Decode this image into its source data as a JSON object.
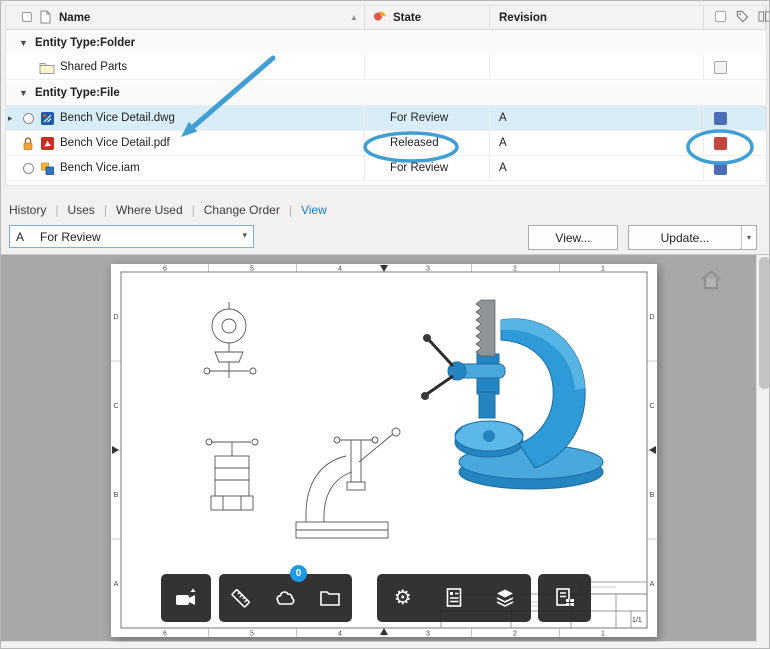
{
  "icons": {
    "sort_asc": "▲",
    "group_expanded": "▼",
    "row_current": "▸",
    "combo_chevron": "▾",
    "split_chevron": "▾",
    "gear": "⚙"
  },
  "grid": {
    "columns": {
      "name": "Name",
      "state": "State",
      "revision": "Revision"
    },
    "group_folder": "Entity Type:Folder",
    "group_file": "Entity Type:File",
    "rows": {
      "shared": {
        "name": "Shared Parts"
      },
      "dwg": {
        "name": "Bench Vice Detail.dwg",
        "state": "For Review",
        "revision": "A",
        "status_color": "#4a6db5"
      },
      "pdf": {
        "name": "Bench Vice Detail.pdf",
        "state": "Released",
        "revision": "A",
        "status_color": "#c2473d"
      },
      "iam": {
        "name": "Bench Vice.iam",
        "state": "For Review",
        "revision": "A",
        "status_color": "#4a6db5"
      }
    }
  },
  "tabs": {
    "items": [
      "History",
      "Uses",
      "Where Used",
      "Change Order",
      "View"
    ],
    "separator": "|",
    "active": "View"
  },
  "controls": {
    "revision": "A",
    "state": "For Review",
    "view_button": "View...",
    "update_button": "Update..."
  },
  "toolbar": {
    "markup_badge": "0"
  },
  "sheet": {
    "zones_top": [
      "6",
      "5",
      "4",
      "3",
      "2",
      "1"
    ],
    "zones_bottom": [
      "6",
      "5",
      "4",
      "3",
      "2",
      "1"
    ],
    "zones_right": [
      "D",
      "C",
      "B",
      "A"
    ],
    "zones_left": [
      "D",
      "C",
      "B",
      "A"
    ],
    "sheet_number": "1/1"
  },
  "annotations": {
    "color": "#3f9fd4"
  }
}
